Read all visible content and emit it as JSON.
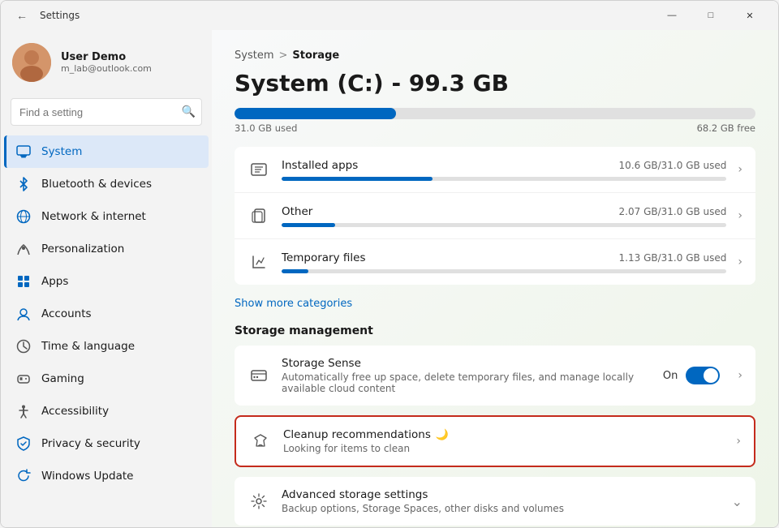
{
  "window": {
    "title": "Settings",
    "controls": {
      "minimize": "—",
      "maximize": "□",
      "close": "✕"
    }
  },
  "sidebar": {
    "user": {
      "name": "User Demo",
      "email": "m_lab@outlook.com",
      "avatar_emoji": "👤"
    },
    "search": {
      "placeholder": "Find a setting",
      "value": ""
    },
    "nav_items": [
      {
        "id": "system",
        "label": "System",
        "icon": "🖥️",
        "active": true
      },
      {
        "id": "bluetooth",
        "label": "Bluetooth & devices",
        "icon": "🔵",
        "active": false
      },
      {
        "id": "network",
        "label": "Network & internet",
        "icon": "🌐",
        "active": false
      },
      {
        "id": "personalization",
        "label": "Personalization",
        "icon": "🖌️",
        "active": false
      },
      {
        "id": "apps",
        "label": "Apps",
        "icon": "📦",
        "active": false
      },
      {
        "id": "accounts",
        "label": "Accounts",
        "icon": "👤",
        "active": false
      },
      {
        "id": "time",
        "label": "Time & language",
        "icon": "🕐",
        "active": false
      },
      {
        "id": "gaming",
        "label": "Gaming",
        "icon": "🎮",
        "active": false
      },
      {
        "id": "accessibility",
        "label": "Accessibility",
        "icon": "♿",
        "active": false
      },
      {
        "id": "privacy",
        "label": "Privacy & security",
        "icon": "🛡️",
        "active": false
      },
      {
        "id": "update",
        "label": "Windows Update",
        "icon": "🔄",
        "active": false
      }
    ]
  },
  "content": {
    "breadcrumb_parent": "System",
    "breadcrumb_sep": ">",
    "breadcrumb_current": "Storage",
    "page_title": "System (C:) - 99.3 GB",
    "storage_used_label": "31.0 GB used",
    "storage_free_label": "68.2 GB free",
    "storage_used_pct": 31,
    "storage_items": [
      {
        "name": "Installed apps",
        "size": "10.6 GB/31.0 GB used",
        "bar_pct": 34,
        "bar_color": "#0067c0"
      },
      {
        "name": "Other",
        "size": "2.07 GB/31.0 GB used",
        "bar_pct": 12,
        "bar_color": "#0067c0"
      },
      {
        "name": "Temporary files",
        "size": "1.13 GB/31.0 GB used",
        "bar_pct": 6,
        "bar_color": "#0067c0"
      }
    ],
    "show_more_label": "Show more categories",
    "mgmt_section_label": "Storage management",
    "mgmt_items": [
      {
        "id": "storage-sense",
        "name": "Storage Sense",
        "desc": "Automatically free up space, delete temporary files, and manage locally available cloud content",
        "has_toggle": true,
        "toggle_on": true,
        "toggle_label": "On",
        "has_chevron": true,
        "highlighted": false
      },
      {
        "id": "cleanup",
        "name": "Cleanup recommendations",
        "loading": true,
        "desc": "Looking for items to clean",
        "has_toggle": false,
        "has_chevron": true,
        "highlighted": true
      },
      {
        "id": "advanced",
        "name": "Advanced storage settings",
        "desc": "Backup options, Storage Spaces, other disks and volumes",
        "has_toggle": false,
        "has_chevron": false,
        "has_expand": true,
        "highlighted": false
      }
    ]
  }
}
